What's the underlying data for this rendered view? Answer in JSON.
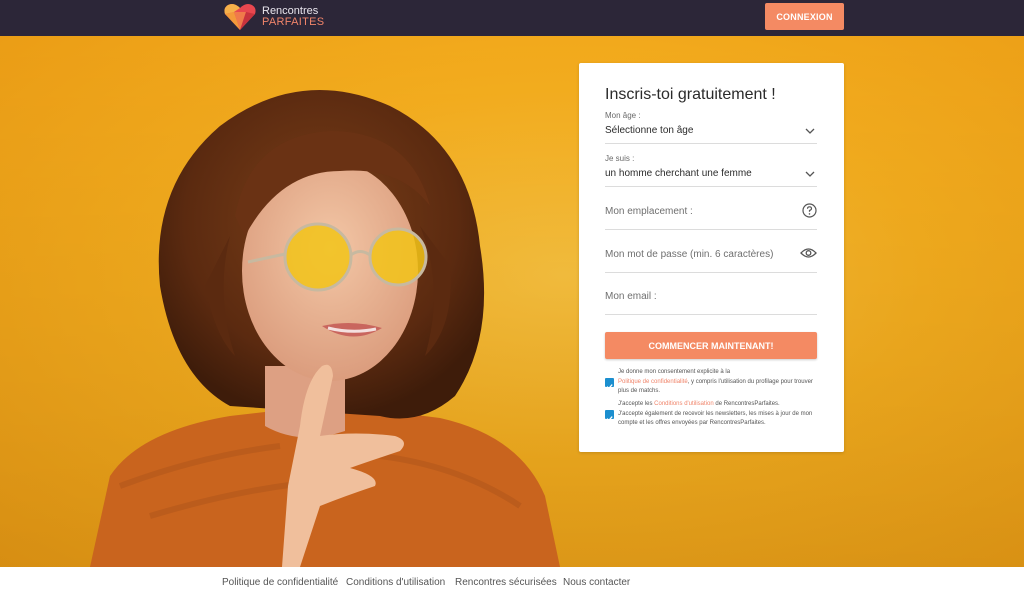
{
  "header": {
    "brand_line1": "Rencontres",
    "brand_line2": "PARFAITES",
    "login_label": "CONNEXION"
  },
  "form": {
    "title": "Inscris-toi gratuitement !",
    "age_label": "Mon âge :",
    "age_value": "Sélectionne ton âge",
    "iam_label": "Je suis :",
    "iam_value": "un homme cherchant une femme",
    "location_placeholder": "Mon emplacement :",
    "password_placeholder": "Mon mot de passe (min. 6 caractères)",
    "email_placeholder": "Mon email :",
    "submit_label": "COMMENCER MAINTENANT!"
  },
  "consent": {
    "c1_pre": "Je donne mon consentement explicite à la",
    "c1_link": "Politique de confidentialité",
    "c1_post": ", y compris l'utilisation du profilage pour trouver plus de matchs.",
    "c2_pre": "J'accepte les",
    "c2_link": "Conditions d'utilisation",
    "c2_mid": "de RencontresParfaites.",
    "c2_post": "J'accepte également de recevoir les newsletters, les mises à jour de mon compte et les offres envoyées par RencontresParfaites."
  },
  "footer": {
    "links": [
      "Politique de confidentialité",
      "Conditions d'utilisation",
      "Rencontres sécurisées",
      "Nous contacter"
    ]
  },
  "colors": {
    "topbar": "#2c2638",
    "accent": "#f48a63",
    "hero_yellow": "#f4ad1e",
    "checkbox": "#1c8fcf"
  },
  "icons": [
    "heart-logo-icon",
    "chevron-down-icon",
    "help-circle-icon",
    "eye-icon",
    "checkbox-checked-icon"
  ]
}
